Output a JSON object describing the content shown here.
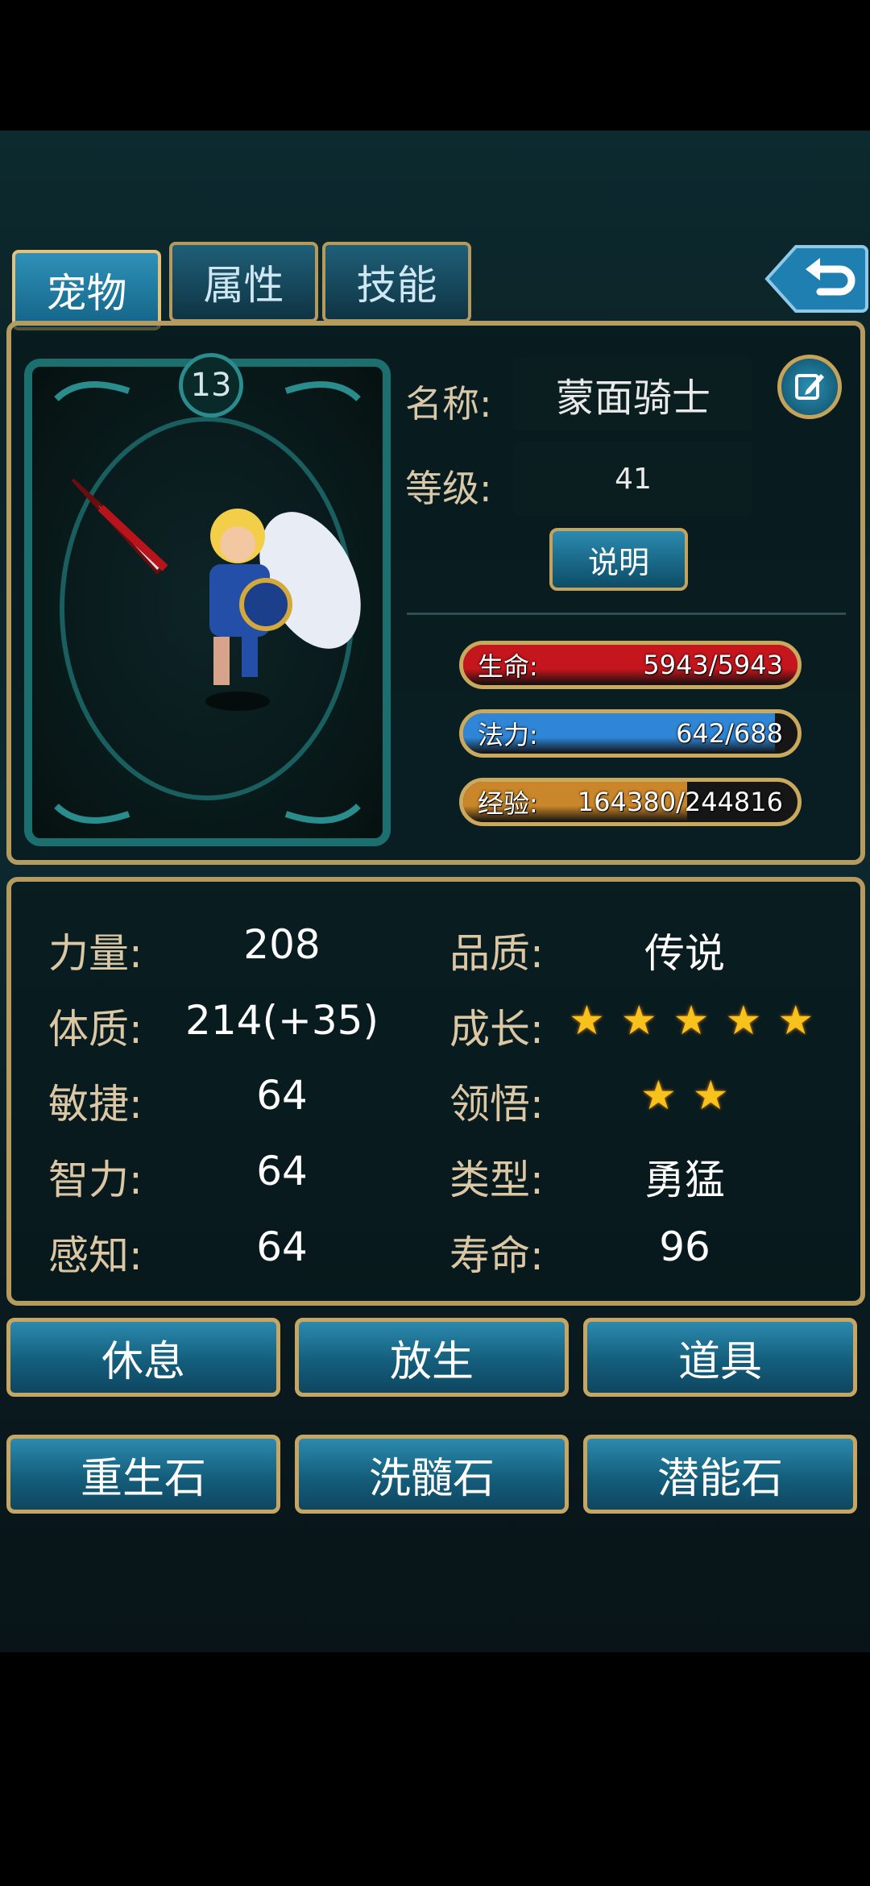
{
  "tabs": [
    {
      "label": "宠物",
      "active": true
    },
    {
      "label": "属性",
      "active": false
    },
    {
      "label": "技能",
      "active": false
    }
  ],
  "pet": {
    "slot_number": "13",
    "name_label": "名称:",
    "name": "蒙面骑士",
    "level_label": "等级:",
    "level": "41",
    "explain_button": "说明"
  },
  "bars": {
    "hp": {
      "label": "生命:",
      "value": "5943/5943",
      "fraction": 1.0,
      "color": "#c4161c"
    },
    "mp": {
      "label": "法力:",
      "value": "642/688",
      "fraction": 0.933,
      "color": "#2f86d6"
    },
    "exp": {
      "label": "经验:",
      "value": "164380/244816",
      "fraction": 0.671,
      "color": "#c9862a"
    }
  },
  "stats_left": [
    {
      "label": "力量:",
      "value": "208"
    },
    {
      "label": "体质:",
      "value": "214(+35)"
    },
    {
      "label": "敏捷:",
      "value": "64"
    },
    {
      "label": "智力:",
      "value": "64"
    },
    {
      "label": "感知:",
      "value": "64"
    }
  ],
  "stats_right": {
    "quality": {
      "label": "品质:",
      "value": "传说"
    },
    "growth": {
      "label": "成长:",
      "stars": 5
    },
    "comprehension": {
      "label": "领悟:",
      "stars": 2
    },
    "type": {
      "label": "类型:",
      "value": "勇猛"
    },
    "lifespan": {
      "label": "寿命:",
      "value": "96"
    }
  },
  "actions_row1": [
    "休息",
    "放生",
    "道具"
  ],
  "actions_row2": [
    "重生石",
    "洗髓石",
    "潜能石"
  ]
}
